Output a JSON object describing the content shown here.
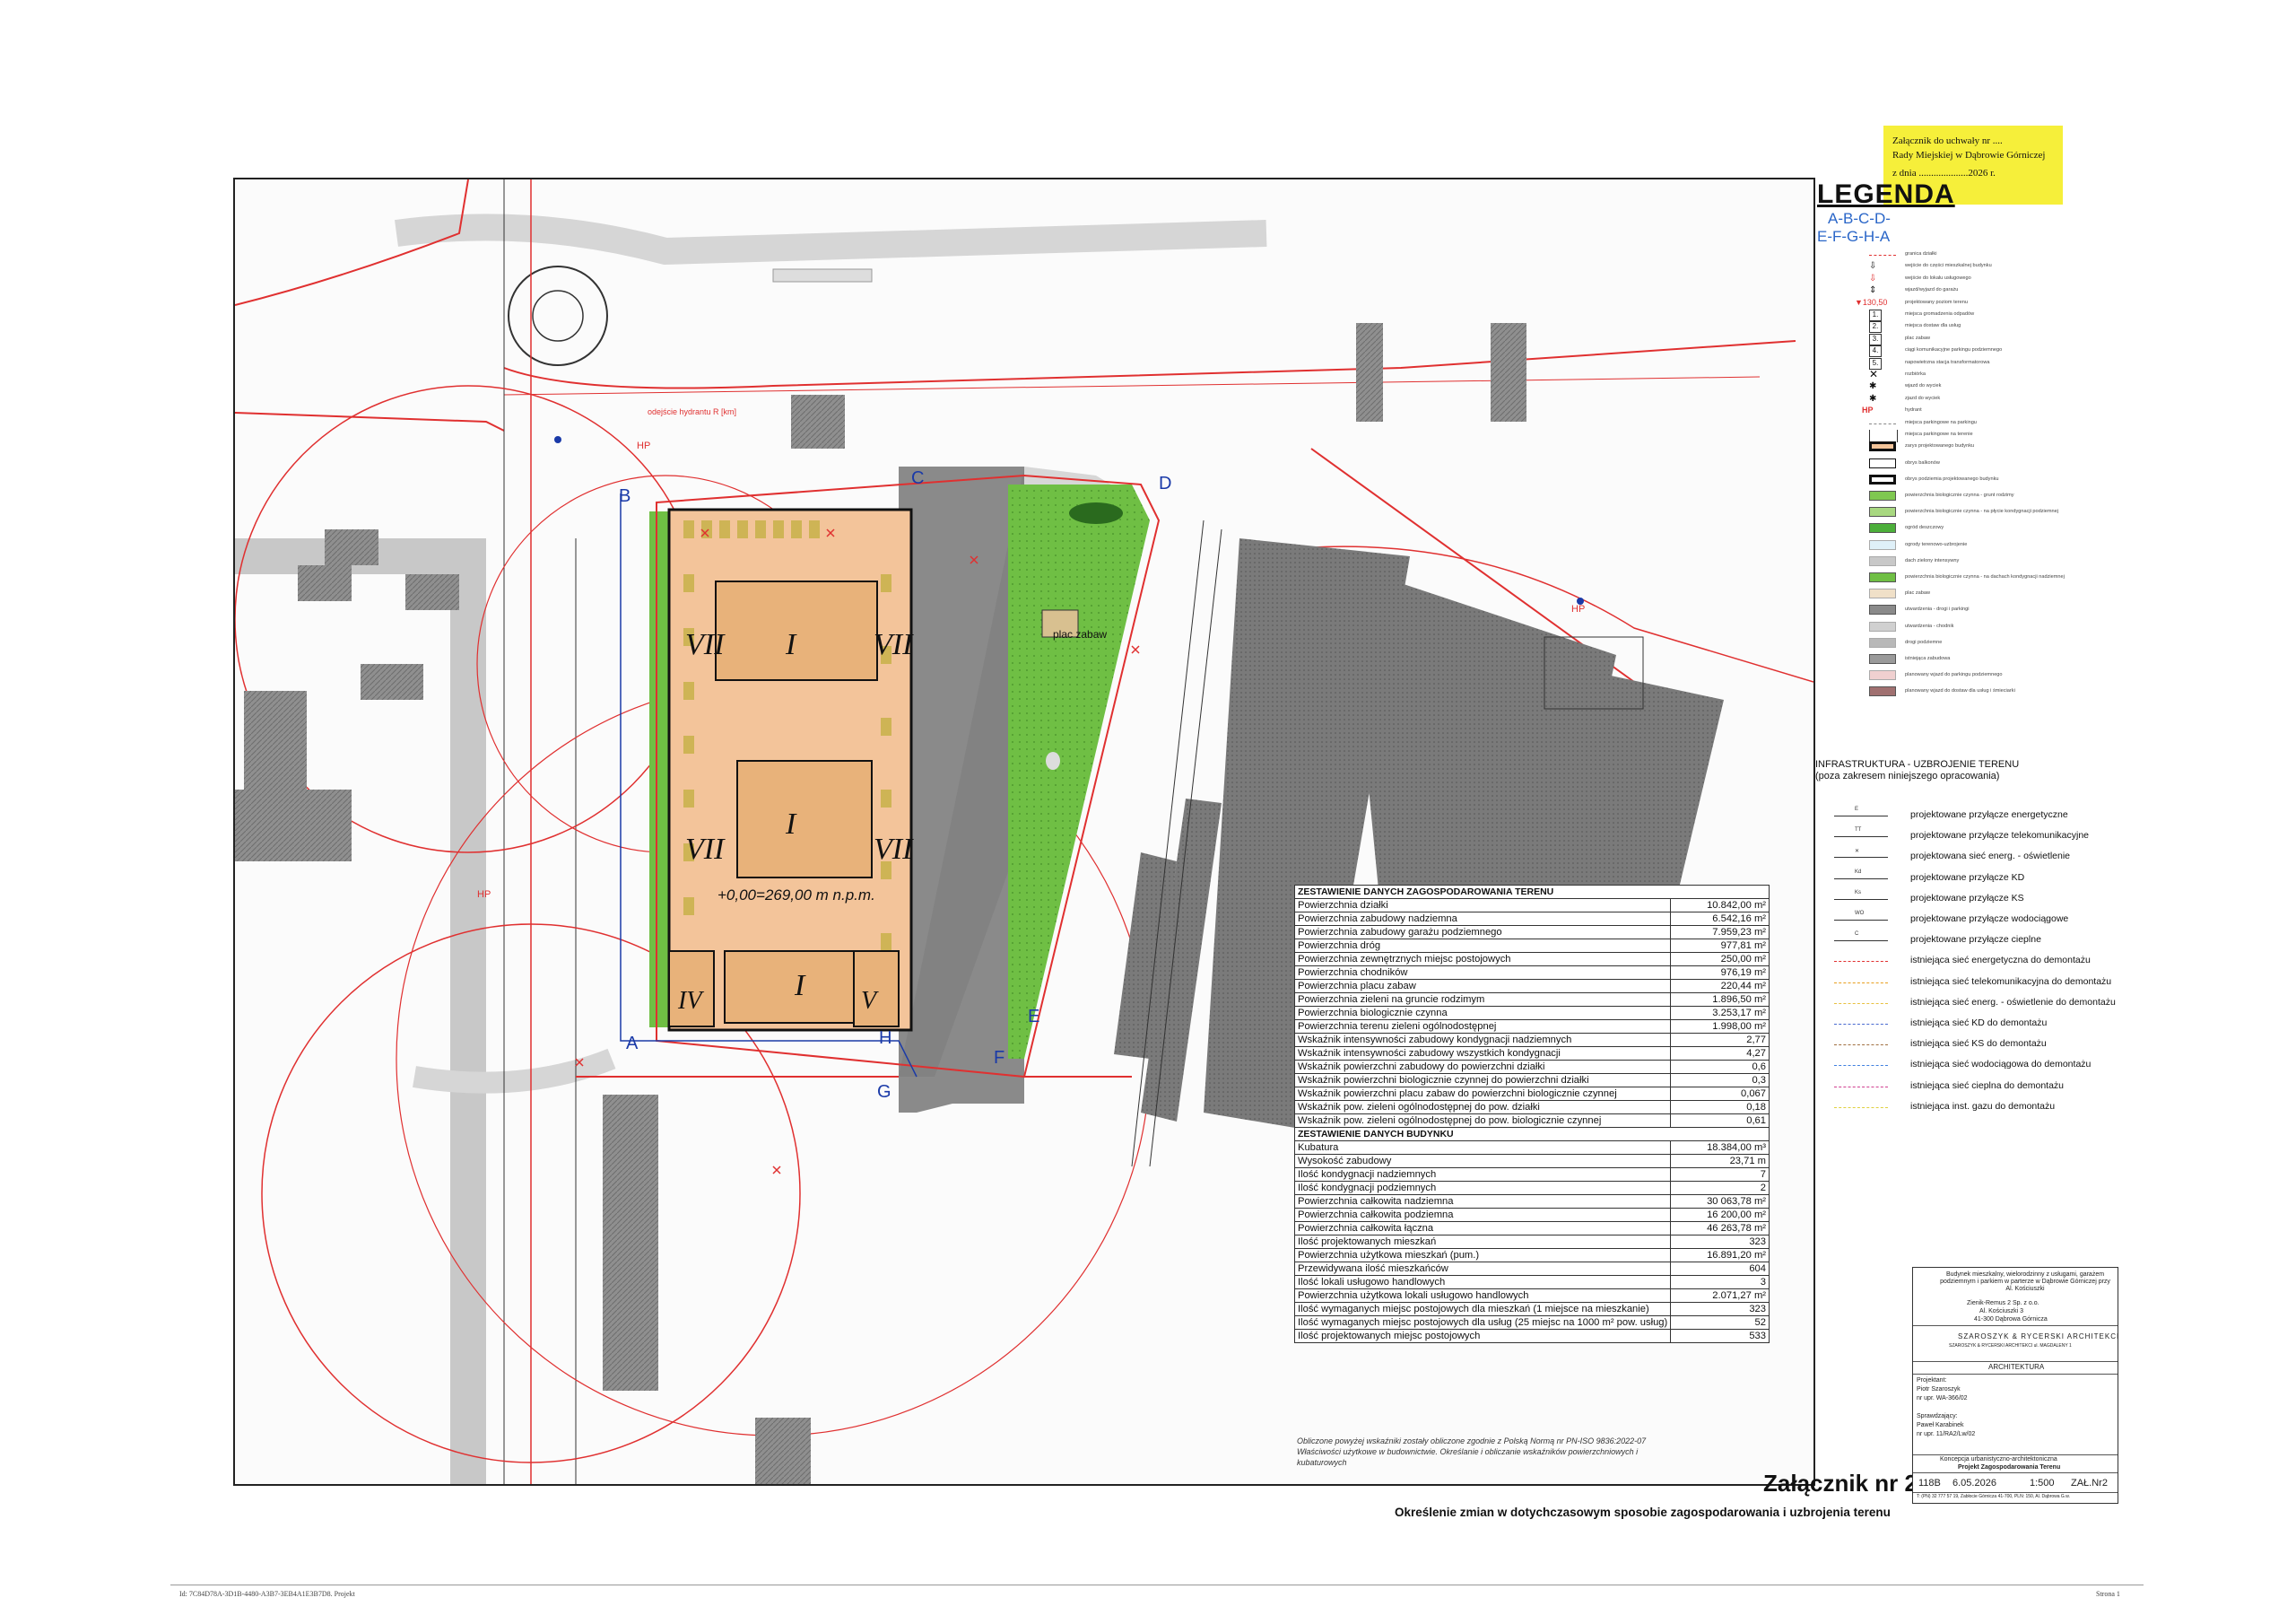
{
  "note": {
    "line1": "Załącznik do uchwały nr ....",
    "line2": "Rady Miejskiej w Dąbrowie Górniczej",
    "line3": "z dnia ....................2026 r."
  },
  "legend": {
    "title": "LEGENDA",
    "code1": "A-B-C-D-",
    "code2": "E-F-G-H-A",
    "items": [
      "granica działki",
      "wejście do części mieszkalnej budynku",
      "wejście do lokalu usługowego",
      "wjazd/wyjazd do garażu",
      "projektowany poziom terenu",
      "miejsca gromadzenia odpadów",
      "miejsca dostaw dla usług",
      "plac zabaw",
      "ciągi komunikacyjne parkingu podziemnego",
      "napowietrzna stacja transformatorowa",
      "rozbiórka",
      "wjazd do wyciek",
      "zjazd do wyciek",
      "hydrant",
      "miejsca parkingowe na parkingu",
      "miejsca parkingowe na terenie",
      "zarys projektowanego budynku",
      "obrys balkonów",
      "obrys podziemia projektowanego budynku",
      "powierzchnia biologicznie czynna - grunt rodzimy",
      "powierzchnia biologicznie czynna - na płycie kondygnacji podziemnej",
      "ogród deszczowy",
      "ogrody terenowo-uzbrojenie",
      "dach zielony intensywny",
      "powierzchnia biologicznie czynna - na dachach kondygnacji nadziemnej",
      "plac zabaw",
      "utwardzenia - drogi i parkingi",
      "utwardzenia - chodnik",
      "drogi podziemne",
      "istniejąca zabudowa",
      "planowany wjazd do parkingu podziemnego",
      "planowany wjazd do dostaw dla usług i śmieciarki"
    ],
    "elevation": "▼130,50",
    "hp": "HP"
  },
  "infra": {
    "title": "INFRASTRUKTURA - UZBROJENIE TERENU",
    "subtitle": "(poza zakresem niniejszego opracowania)",
    "items": [
      {
        "code": "E",
        "label": "projektowane przyłącze energetyczne",
        "color": "#333333"
      },
      {
        "code": "TT",
        "label": "projektowane przyłącze telekomunikacyjne",
        "color": "#333333"
      },
      {
        "code": "✕",
        "label": "projektowana sieć energ. - oświetlenie",
        "color": "#333333"
      },
      {
        "code": "Kd",
        "label": "projektowane przyłącze KD",
        "color": "#333333"
      },
      {
        "code": "Ks",
        "label": "projektowane przyłącze KS",
        "color": "#333333"
      },
      {
        "code": "WO",
        "label": "projektowane przyłącze wodociągowe",
        "color": "#333333"
      },
      {
        "code": "C",
        "label": "projektowane przyłącze cieplne",
        "color": "#333333"
      },
      {
        "code": "",
        "label": "istniejąca sieć energetyczna do demontażu",
        "color": "#e03030"
      },
      {
        "code": "",
        "label": "istniejąca sieć telekomunikacyjna do demontażu",
        "color": "#e8a020"
      },
      {
        "code": "",
        "label": "istniejąca sieć energ. - oświetlenie do demontażu",
        "color": "#e8c040"
      },
      {
        "code": "",
        "label": "istniejąca sieć KD do demontażu",
        "color": "#4a6ad0"
      },
      {
        "code": "",
        "label": "istniejąca sieć KS do demontażu",
        "color": "#a07040"
      },
      {
        "code": "",
        "label": "istniejąca sieć wodociągowa do demontażu",
        "color": "#4080e0"
      },
      {
        "code": "",
        "label": "istniejąca sieć cieplna do demontażu",
        "color": "#d04090"
      },
      {
        "code": "",
        "label": "istniejąca inst. gazu do demontażu",
        "color": "#e0d040"
      }
    ]
  },
  "table": {
    "section1": "ZESTAWIENIE DANYCH ZAGOSPODAROWANIA TERENU",
    "rows1": [
      [
        "Powierzchnia działki",
        "10.842,00 m²"
      ],
      [
        "Powierzchnia zabudowy nadziemna",
        "6.542,16 m²"
      ],
      [
        "Powierzchnia zabudowy garażu podziemnego",
        "7.959,23 m²"
      ],
      [
        "Powierzchnia dróg",
        "977,81 m²"
      ],
      [
        "Powierzchnia zewnętrznych miejsc postojowych",
        "250,00 m²"
      ],
      [
        "Powierzchnia chodników",
        "976,19 m²"
      ],
      [
        "Powierzchnia placu zabaw",
        "220,44 m²"
      ],
      [
        "Powierzchnia zieleni na gruncie rodzimym",
        "1.896,50 m²"
      ],
      [
        "Powierzchnia biologicznie czynna",
        "3.253,17 m²"
      ],
      [
        "Powierzchnia terenu zieleni ogólnodostępnej",
        "1.998,00 m²"
      ],
      [
        "Wskaźnik intensywności zabudowy kondygnacji nadziemnych",
        "2,77"
      ],
      [
        "Wskaźnik intensywności zabudowy wszystkich kondygnacji",
        "4,27"
      ],
      [
        "Wskaźnik powierzchni zabudowy do powierzchni działki",
        "0,6"
      ],
      [
        "Wskaźnik powierzchni biologicznie czynnej do powierzchni działki",
        "0,3"
      ],
      [
        "Wskaźnik powierzchni placu zabaw do powierzchni biologicznie czynnej",
        "0,067"
      ],
      [
        "Wskaźnik pow. zieleni ogólnodostępnej do pow. działki",
        "0,18"
      ],
      [
        "Wskaźnik pow. zieleni ogólnodostępnej do pow. biologicznie czynnej",
        "0,61"
      ]
    ],
    "section2": "ZESTAWIENIE DANYCH BUDYNKU",
    "rows2": [
      [
        "Kubatura",
        "18.384,00 m³"
      ],
      [
        "Wysokość zabudowy",
        "23,71 m"
      ],
      [
        "Ilość kondygnacji nadziemnych",
        "7"
      ],
      [
        "Ilość kondygnacji podziemnych",
        "2"
      ],
      [
        "Powierzchnia całkowita nadziemna",
        "30 063,78 m²"
      ],
      [
        "Powierzchnia całkowita podziemna",
        "16 200,00 m²"
      ],
      [
        "Powierzchnia całkowita łączna",
        "46 263,78 m²"
      ],
      [
        "Ilość projektowanych mieszkań",
        "323"
      ],
      [
        "Powierzchnia użytkowa mieszkań (pum.)",
        "16.891,20 m²"
      ],
      [
        "Przewidywana ilość mieszkańców",
        "604"
      ],
      [
        "Ilość lokali usługowo handlowych",
        "3"
      ],
      [
        "Powierzchnia użytkowa lokali usługowo handlowych",
        "2.071,27 m²"
      ],
      [
        "Ilość wymaganych miejsc postojowych dla mieszkań (1 miejsce na mieszkanie)",
        "323"
      ],
      [
        "Ilość wymaganych miejsc postojowych dla usług (25 miejsc na 1000 m² pow. usług)",
        "52"
      ],
      [
        "Ilość projektowanych miejsc postojowych",
        "533"
      ]
    ],
    "note": "Obliczone powyżej wskaźniki zostały obliczone zgodnie z Polską Normą nr PN-ISO 9836:2022-07 Właściwości użytkowe w budownictwie. Określanie i obliczanie wskaźników powierzchniowych i kubaturowych"
  },
  "titles": {
    "main": "Załącznik nr 2",
    "sub": "Określenie zmian w dotychczasowym sposobie zagospodarowania i uzbrojenia terenu"
  },
  "map": {
    "elevation_label": "+0,00=269,00 m n.p.m.",
    "playground": "plac zabaw",
    "hydrant_label": "odejście hydrantu R [km]",
    "points": [
      "A",
      "B",
      "C",
      "D",
      "E",
      "F",
      "G",
      "H"
    ],
    "floors": [
      "VII",
      "I",
      "VII",
      "VII",
      "I",
      "VII",
      "IV",
      "I",
      "V"
    ]
  },
  "titleblock": {
    "investment": "Budynek mieszkalny, wielorodzinny z usługami, garażem podziemnym i parkiem w parterze w Dąbrowie Górniczej przy Al. Kościuszki",
    "investor1": "Zienik-Remus 2 Sp. z o.o.",
    "investor2": "Al. Kościuszki 3",
    "investor3": "41-300 Dąbrowa Górnicza",
    "office1": "SZAROSZYK & RYCERSKI ARCHITEKCI",
    "office2": "SZAROSZYK & RYCERSKI ARCHITEKCI ul. MAGDALENY 1",
    "branch": "ARCHITEKTURA",
    "designer_role": "Projektant:",
    "designer": "Piotr Szaroszyk",
    "number": "nr upr. WA-366/02",
    "checker_role": "Sprawdzający:",
    "checker": "Paweł Karabinek",
    "number2": "nr upr. 11/RA2/Lw/02",
    "stage": "Koncepcja urbanistyczno-architektoniczna",
    "drawing": "Projekt Zagospodarowania Terenu",
    "job": "118B",
    "date": "6.05.2026",
    "scale": "1:500",
    "sheet": "ZAŁ.Nr2",
    "footer": "T: (PN) 32 777 57 19, Zabłocie Górnicza 41-700, PLN: 150, Al. Dąbrowa G.w."
  },
  "footer": {
    "left": "Id: 7C84D78A-3D1B-4480-A3B7-3EB4A1E3B7D8. Projekt",
    "right": "Strona 1"
  },
  "colors": {
    "plot_red": "#e03030",
    "building_fill": "#f3c49a",
    "building_hatch": "#c8b24a",
    "green": "#6fbf44",
    "road_gray": "#8a8a8a",
    "existing_building": "#9a9a9a",
    "label_blue": "#1a3aa8"
  }
}
